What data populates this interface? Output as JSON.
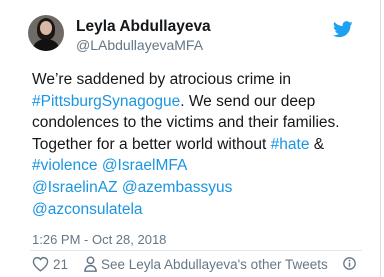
{
  "author": {
    "display_name": "Leyla Abdullayeva",
    "handle": "@LAbdullayevaMFA",
    "avatar_icon": "profile-photo"
  },
  "tweet": {
    "segments": [
      {
        "text": "We’re saddened by atrocious crime in\n",
        "link": false
      },
      {
        "text": "#PittsburgSynagogue",
        "link": true
      },
      {
        "text": ". We send our deep\ncondolences to the victims and their families.\nTogether for a better world without ",
        "link": false
      },
      {
        "text": "#hate",
        "link": true
      },
      {
        "text": " &\n",
        "link": false
      },
      {
        "text": "#violence",
        "link": true
      },
      {
        "text": " ",
        "link": false
      },
      {
        "text": "@IsraelMFA",
        "link": true
      },
      {
        "text": "\n",
        "link": false
      },
      {
        "text": "@IsraelinAZ",
        "link": true
      },
      {
        "text": " ",
        "link": false
      },
      {
        "text": "@azembassyus",
        "link": true
      },
      {
        "text": "\n",
        "link": false
      },
      {
        "text": "@azconsulatela",
        "link": true
      }
    ],
    "timestamp": "1:26 PM - Oct 28, 2018"
  },
  "footer": {
    "like_count": "21",
    "profile_link": "See Leyla Abdullayeva's other Tweets"
  },
  "icons": {
    "brand": "twitter-bird-icon",
    "like": "heart-icon",
    "profile": "person-icon",
    "info": "info-icon"
  },
  "colors": {
    "link": "#1b95e0",
    "brand": "#1da1f2",
    "muted": "#657786",
    "text": "#14171a"
  }
}
